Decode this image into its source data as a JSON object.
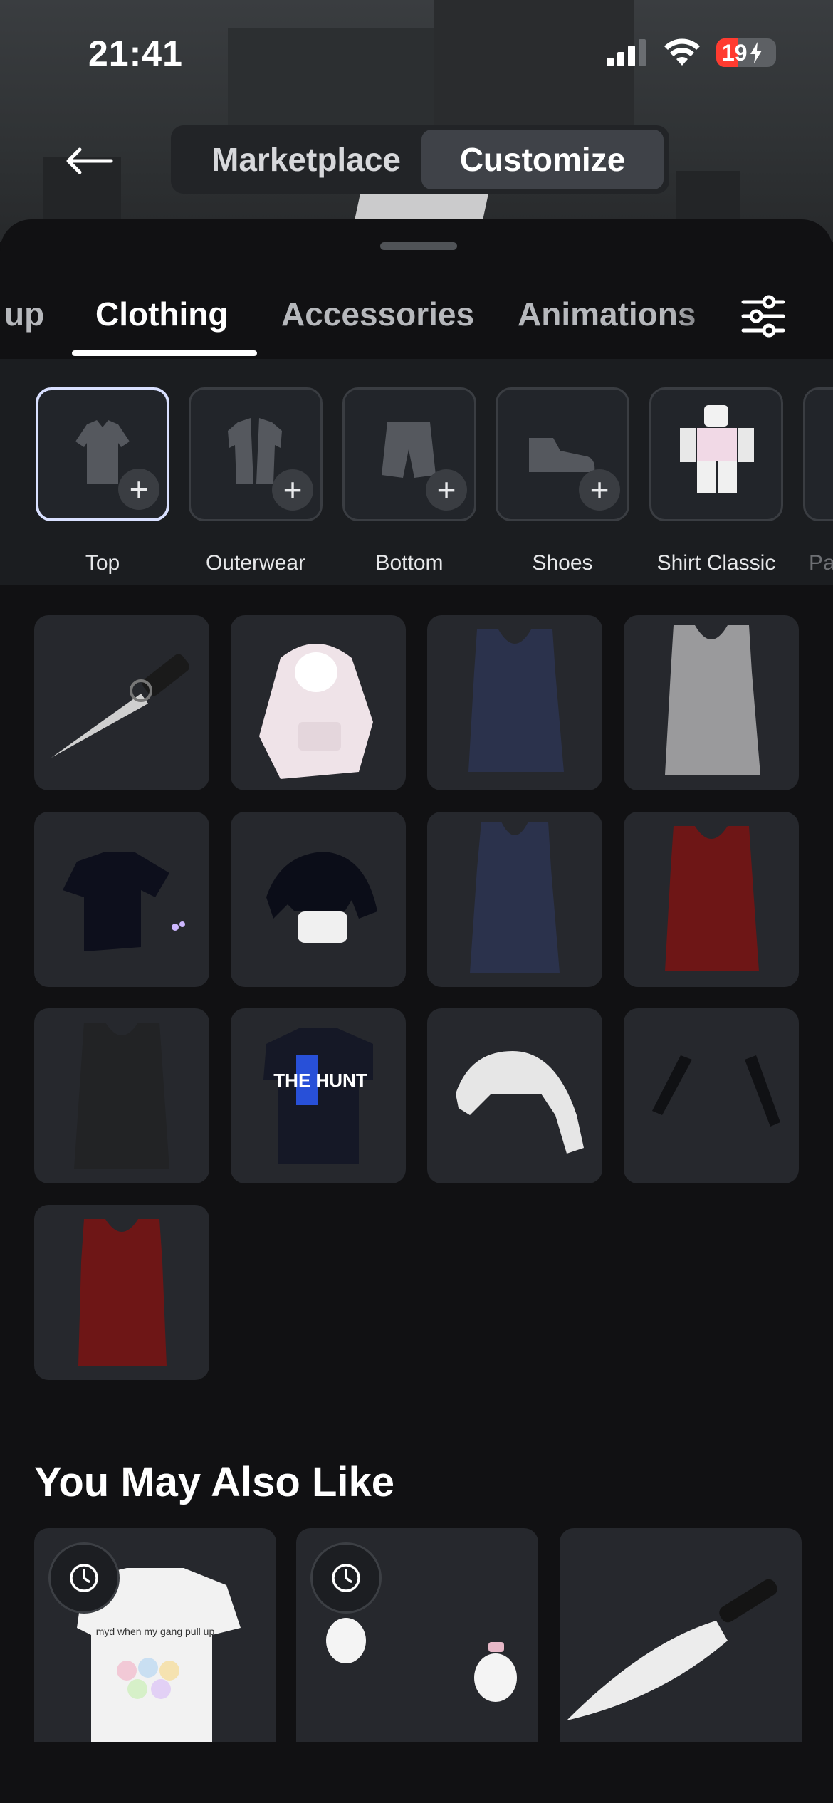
{
  "status_bar": {
    "time": "21:41",
    "battery": "19"
  },
  "header": {
    "segments": [
      {
        "label": "Marketplace",
        "active": false
      },
      {
        "label": "Customize",
        "active": true
      }
    ]
  },
  "tabs": [
    {
      "label": "up",
      "active": false
    },
    {
      "label": "Clothing",
      "active": true
    },
    {
      "label": "Accessories",
      "active": false
    },
    {
      "label": "Animations",
      "active": false
    }
  ],
  "categories": [
    {
      "label": "Top",
      "icon": "shirt-icon",
      "selected": true
    },
    {
      "label": "Outerwear",
      "icon": "jacket-icon",
      "selected": false
    },
    {
      "label": "Bottom",
      "icon": "shorts-icon",
      "selected": false
    },
    {
      "label": "Shoes",
      "icon": "shoe-icon",
      "selected": false
    },
    {
      "label": "Shirt Classic",
      "icon": "avatar-figure-icon",
      "selected": false
    },
    {
      "label": "Pa",
      "icon": "",
      "selected": false
    }
  ],
  "items": [
    {
      "name": "knife-item"
    },
    {
      "name": "pink-hoodie-item"
    },
    {
      "name": "navy-tank-top-item"
    },
    {
      "name": "gray-tank-top-item"
    },
    {
      "name": "black-tshirt-item"
    },
    {
      "name": "black-crop-top-item"
    },
    {
      "name": "navy-tank-top-item-2"
    },
    {
      "name": "red-tank-top-item"
    },
    {
      "name": "black-tank-top-item"
    },
    {
      "name": "the-hunt-tshirt-item"
    },
    {
      "name": "white-crop-sweater-item"
    },
    {
      "name": "black-gloves-item"
    },
    {
      "name": "red-tank-top-item-2"
    }
  ],
  "recommendations": {
    "title": "You May Also Like",
    "cards": [
      {
        "name": "white-graphic-tshirt",
        "print_text": "myd when my gang pull up",
        "timed": true
      },
      {
        "name": "white-mittens",
        "timed": true
      },
      {
        "name": "kitchen-knife",
        "timed": false
      }
    ]
  },
  "item_print_text": {
    "hunt_shirt": "THE HUNT"
  },
  "colors": {
    "accent_selected": "#d9e0ff",
    "battery_low": "#ff3b30"
  }
}
